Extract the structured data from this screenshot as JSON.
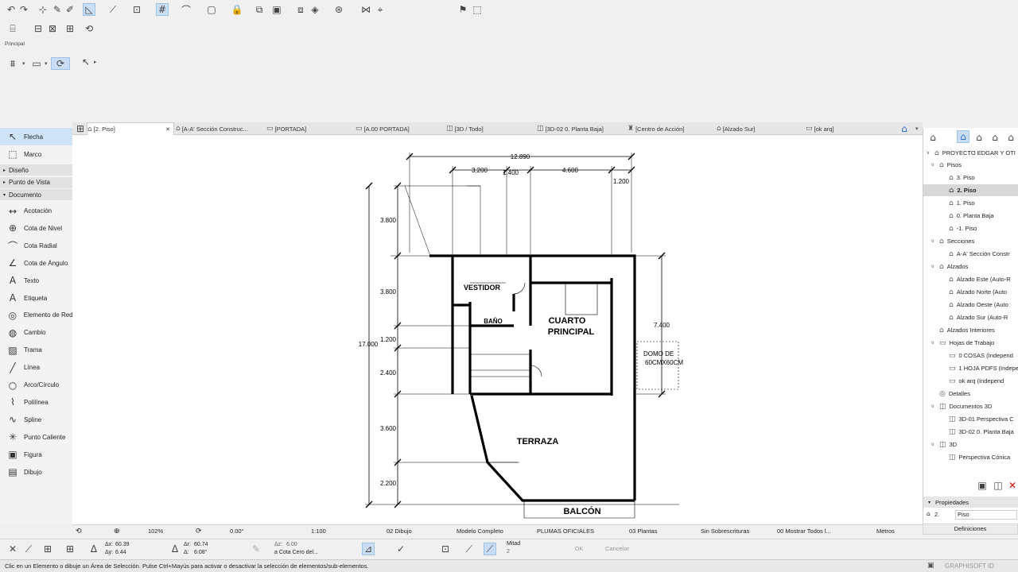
{
  "toolbar": {
    "row1_icons": [
      "undo-icon",
      "redo-icon",
      "pick-up-icon",
      "eyedropper-icon",
      "inject-icon",
      "guide-lines-icon",
      "snap-guides-icon",
      "gravity-icon",
      "grid-snap-icon",
      "drafting-aids-icon",
      "selection-icon",
      "lock-icon",
      "layer-icon",
      "group-icon",
      "suspend-groups-icon",
      "trace-icon",
      "teamwork-icon",
      "section-icon",
      "elevation-icon",
      "flag-icon",
      "marquee-icon"
    ],
    "row2_icons": [
      "floor-icon",
      "plan-icon",
      "renovation-icon",
      "layers-icon",
      "properties-icon"
    ],
    "info_label": "Principal"
  },
  "toolbox": {
    "selected": "Flecha",
    "top_tools": [
      {
        "label": "Flecha",
        "icon": "↖",
        "name": "arrow-tool"
      },
      {
        "label": "Marco",
        "icon": "⬚",
        "name": "marquee-tool"
      }
    ],
    "groups": [
      "Diseño",
      "Punto de Vista",
      "Documento"
    ],
    "document_tools": [
      {
        "label": "Acotación",
        "icon": "↔",
        "name": "dimension-tool"
      },
      {
        "label": "Cota de Nivel",
        "icon": "⊕",
        "name": "level-dimension-tool"
      },
      {
        "label": "Cota Radial",
        "icon": "⌒",
        "name": "radial-dimension-tool"
      },
      {
        "label": "Cota de Ángulo",
        "icon": "∠",
        "name": "angle-dimension-tool"
      },
      {
        "label": "Texto",
        "icon": "A",
        "name": "text-tool"
      },
      {
        "label": "Etiqueta",
        "icon": "A",
        "name": "label-tool"
      },
      {
        "label": "Elemento de Red",
        "icon": "◎",
        "name": "grid-element-tool"
      },
      {
        "label": "Cambio",
        "icon": "◍",
        "name": "change-tool"
      },
      {
        "label": "Trama",
        "icon": "▨",
        "name": "fill-tool"
      },
      {
        "label": "Línea",
        "icon": "╱",
        "name": "line-tool"
      },
      {
        "label": "Arco/Círculo",
        "icon": "○",
        "name": "arc-tool"
      },
      {
        "label": "Polilínea",
        "icon": "⌇",
        "name": "polyline-tool"
      },
      {
        "label": "Spline",
        "icon": "∿",
        "name": "spline-tool"
      },
      {
        "label": "Punto Caliente",
        "icon": "✳",
        "name": "hotspot-tool"
      },
      {
        "label": "Figura",
        "icon": "▣",
        "name": "figure-tool"
      },
      {
        "label": "Dibujo",
        "icon": "▤",
        "name": "drawing-tool"
      }
    ]
  },
  "tabs": [
    {
      "label": "[2. Piso]",
      "icon": "⌂",
      "active": true
    },
    {
      "label": "[A-A' Sección Construc...",
      "icon": "⌂"
    },
    {
      "label": "[PORTADA]",
      "icon": "▭"
    },
    {
      "label": "[A.00 PORTADA]",
      "icon": "▭"
    },
    {
      "label": "[3D / Todo]",
      "icon": "◫"
    },
    {
      "label": "[3D-02 0. Planta Baja]",
      "icon": "◫"
    },
    {
      "label": "[Centro de Acción]",
      "icon": "♜"
    },
    {
      "label": "[Alzado Sur]",
      "icon": "⌂"
    },
    {
      "label": "[ok arq]",
      "icon": "▭"
    }
  ],
  "drawing": {
    "dims_top": [
      "12.890",
      "3.200",
      "1.400",
      "4.600",
      "1.200"
    ],
    "dims_left": [
      "3.800",
      "3.800",
      "1.200",
      "2.400",
      "3.600",
      "2.200"
    ],
    "dim_total_left": "17.000",
    "dim_right": "7.400",
    "rooms": [
      "VESTIDOR",
      "BAÑO",
      "CUARTO",
      "PRINCIPAL",
      "TERRAZA",
      "BALCÓN"
    ],
    "note_line1": "DOMO DE",
    "note_line2": "60CMX60CM"
  },
  "navigator": {
    "project": "PROYECTO EDGAR Y OTI",
    "items": [
      {
        "label": "Pisos",
        "level": 1,
        "tw": "v",
        "icon": "⌂"
      },
      {
        "label": "3. Piso",
        "level": 2,
        "icon": "⌂"
      },
      {
        "label": "2. Piso",
        "level": 2,
        "icon": "⌂",
        "selected": true
      },
      {
        "label": "1. Piso",
        "level": 2,
        "icon": "⌂"
      },
      {
        "label": "0. Planta Baja",
        "level": 2,
        "icon": "⌂"
      },
      {
        "label": "-1. Piso",
        "level": 2,
        "icon": "⌂"
      },
      {
        "label": "Secciones",
        "level": 1,
        "tw": "v",
        "icon": "⌂"
      },
      {
        "label": "A-A' Sección Constr",
        "level": 2,
        "icon": "⌂"
      },
      {
        "label": "Alzados",
        "level": 1,
        "tw": "v",
        "icon": "⌂"
      },
      {
        "label": "Alzado Este (Auto-R",
        "level": 2,
        "icon": "⌂"
      },
      {
        "label": "Alzado Norte (Auto",
        "level": 2,
        "icon": "⌂"
      },
      {
        "label": "Alzado Oeste (Auto",
        "level": 2,
        "icon": "⌂"
      },
      {
        "label": "Alzado Sur (Auto-R",
        "level": 2,
        "icon": "⌂"
      },
      {
        "label": "Alzados Interiores",
        "level": 1,
        "icon": "⌂"
      },
      {
        "label": "Hojas de Trabajo",
        "level": 1,
        "tw": "v",
        "icon": "▭"
      },
      {
        "label": "0 COSAS (Independ",
        "level": 2,
        "icon": "▭"
      },
      {
        "label": "1 HOJA PDFS (Indepe",
        "level": 2,
        "icon": "▭"
      },
      {
        "label": "ok arq (Independ",
        "level": 2,
        "icon": "▭"
      },
      {
        "label": "Detalles",
        "level": 1,
        "icon": "◎"
      },
      {
        "label": "Documentos 3D",
        "level": 1,
        "tw": "v",
        "icon": "◫"
      },
      {
        "label": "3D-01 Perspectiva C",
        "level": 2,
        "icon": "◫"
      },
      {
        "label": "3D-02 0. Planta Baja",
        "level": 2,
        "icon": "◫"
      },
      {
        "label": "3D",
        "level": 1,
        "tw": "v",
        "icon": "◫"
      },
      {
        "label": "Perspectiva Cónica",
        "level": 2,
        "icon": "◫"
      }
    ],
    "properties_header": "Propiedades",
    "prop_key": "2.",
    "prop_value": "Piso",
    "definitions": "Definiciones"
  },
  "statusbar": {
    "zoom": "102%",
    "angle": "0.00°",
    "scale": "1:100",
    "drawing": "02 Dibujo",
    "model": "Modelo Completo",
    "pens": "PLUMAS OFICIALES",
    "plants": "03 Plantas",
    "overrides": "Sin Sobrescrituras",
    "show": "00 Mostrar Todos l...",
    "units": "Metros"
  },
  "infobox": {
    "x": "60.39",
    "y": "6.44",
    "r": "60.74",
    "a": "6.08°",
    "dz": "6.00",
    "ref": "a Cota Cero del...",
    "snap_label": "Mitad",
    "snap_value": "2",
    "ok": "OK",
    "cancel": "Cancelar"
  },
  "footer": {
    "message": "Clic en un Elemento o dibuje un Área de Selección. Pulse Ctrl+Mayús para activar o desactivar la selección de elementos/sub-elementos.",
    "brand": "GRAPHISOFT ID"
  }
}
